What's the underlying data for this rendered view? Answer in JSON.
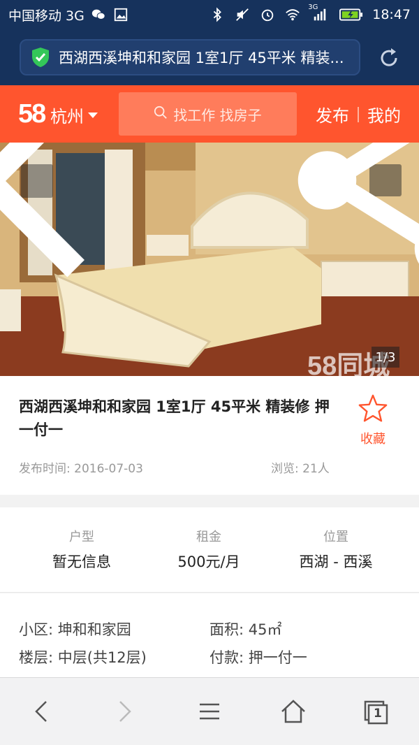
{
  "status_bar": {
    "carrier": "中国移动 3G",
    "time": "18:47",
    "network_badge": "3G",
    "icons": [
      "wechat-icon",
      "image-icon",
      "bluetooth-icon",
      "mute-icon",
      "alarm-icon",
      "wifi-icon",
      "signal-icon",
      "battery-icon"
    ]
  },
  "browser": {
    "url_text": "西湖西溪坤和和家园 1室1厅 45平米 精装...",
    "tab_count": "1"
  },
  "header": {
    "logo": "58",
    "city": "杭州",
    "search_placeholder": "找工作 找房子",
    "post_label": "发布",
    "mine_label": "我的"
  },
  "photo": {
    "watermark": "58同城",
    "counter": "1/3"
  },
  "listing": {
    "title": "西湖西溪坤和和家园 1室1厅 45平米 精装修 押一付一",
    "favorite_label": "收藏",
    "publish_time": "发布时间: 2016-07-03",
    "views": "浏览: 21人"
  },
  "summary": [
    {
      "label": "户型",
      "value": "暂无信息"
    },
    {
      "label": "租金",
      "value": "500元/月"
    },
    {
      "label": "位置",
      "value": "西湖 - 西溪"
    }
  ],
  "details": {
    "community": "小区: 坤和和家园",
    "area": "面积: 45㎡",
    "floor": "楼层: 中层(共12层)",
    "payment": "付款: 押一付一"
  },
  "colors": {
    "brand": "#ff552e",
    "status_bar": "#16325c",
    "favorite": "#ff552e"
  }
}
